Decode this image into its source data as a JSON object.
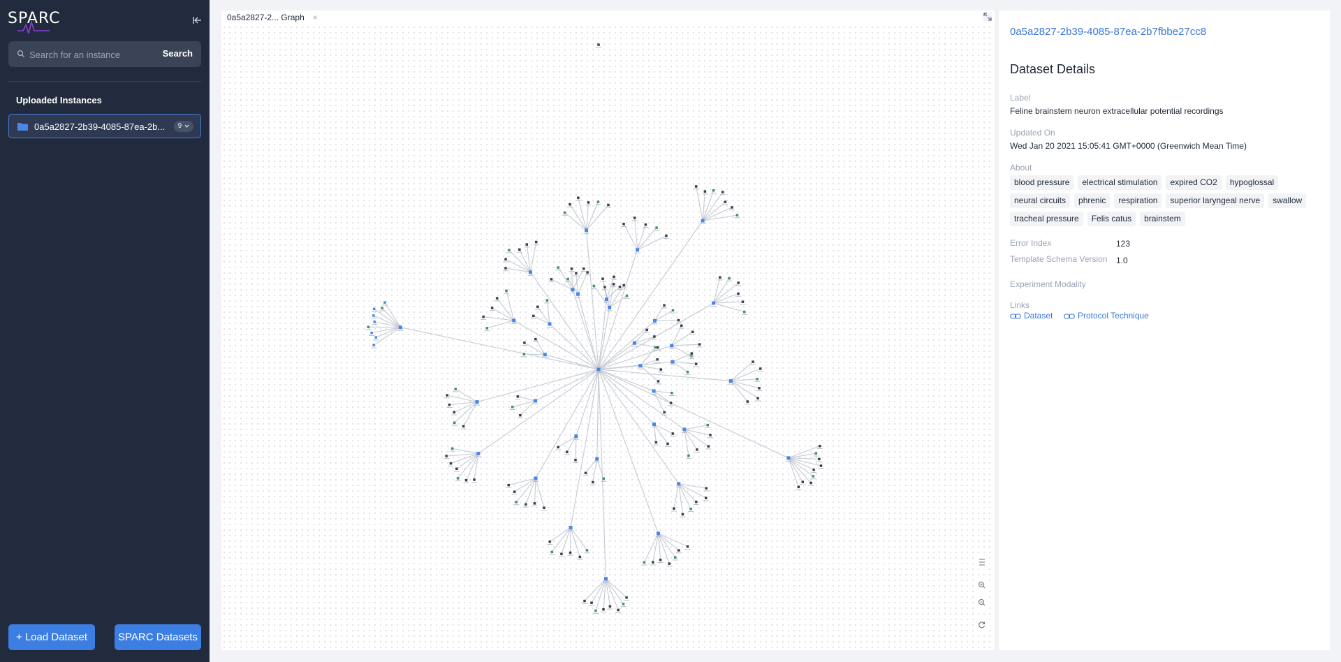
{
  "sidebar": {
    "logo": "SPARC",
    "search": {
      "placeholder": "Search for an instance",
      "button": "Search"
    },
    "section_title": "Uploaded Instances",
    "instance": {
      "label": "0a5a2827-2b39-4085-87ea-2b...",
      "count": "9"
    },
    "buttons": {
      "load": "+ Load Dataset",
      "sparc": "SPARC Datasets"
    }
  },
  "graph": {
    "tab_label": "0a5a2827-2... Graph",
    "tab_close": "×"
  },
  "details": {
    "dataset_id": "0a5a2827-2b39-4085-87ea-2b7fbbe27cc8",
    "title": "Dataset Details",
    "label": {
      "name": "Label",
      "value": "Feline brainstem neuron extracellular potential recordings"
    },
    "updated": {
      "name": "Updated On",
      "value": "Wed Jan 20 2021 15:05:41 GMT+0000 (Greenwich Mean Time)"
    },
    "about": {
      "name": "About",
      "tags": [
        "blood pressure",
        "electrical stimulation",
        "expired CO2",
        "hypoglossal",
        "neural circuits",
        "phrenic",
        "respiration",
        "superior laryngeal nerve",
        "swallow",
        "tracheal pressure",
        "Felis catus",
        "brainstem"
      ]
    },
    "error_index": {
      "name": "Error Index",
      "value": "123"
    },
    "template_schema": {
      "name": "Template Schema Version",
      "value": "1.0"
    },
    "experiment_modality": {
      "name": "Experiment Modality"
    },
    "links": {
      "name": "Links",
      "dataset": "Dataset",
      "protocol": "Protocol Technique"
    }
  },
  "colors": {
    "accent": "#3d7ee3",
    "sidebar": "#222b3d",
    "link": "#3a77d8",
    "edge": "#c9ced6",
    "node_blue": "#4a86e8",
    "node_dark": "#3a3f4b",
    "node_green": "#3f8f6a"
  },
  "icons": [
    "search-icon",
    "collapse-icon",
    "folder-icon",
    "chevron-down-icon",
    "expand-icon",
    "fit-icon",
    "zoom-in-icon",
    "zoom-out-icon",
    "reset-icon",
    "link-icon"
  ]
}
